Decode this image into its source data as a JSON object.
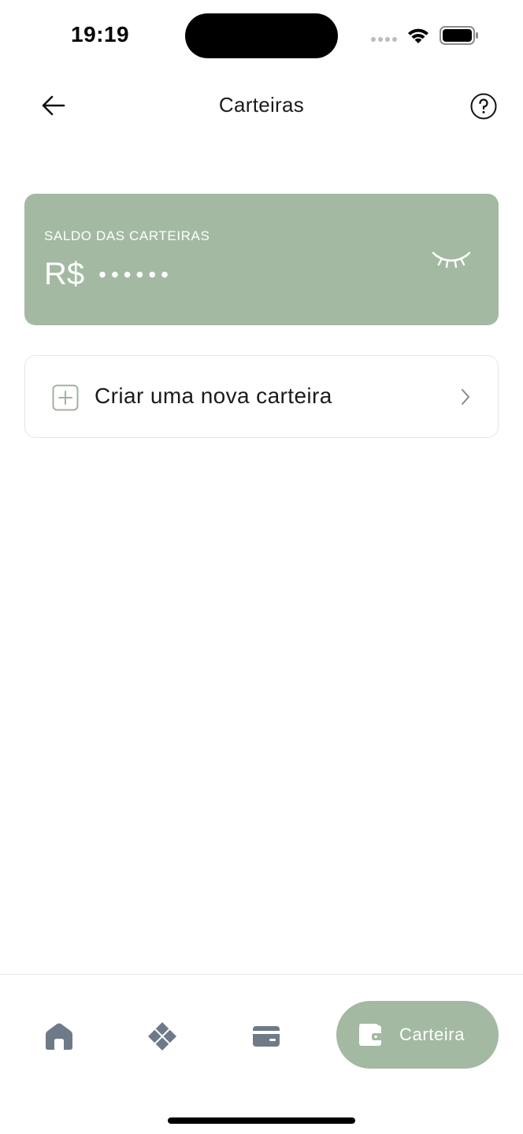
{
  "status_bar": {
    "time": "19:19"
  },
  "header": {
    "title": "Carteiras",
    "back_icon": "arrow-left-icon",
    "help_icon": "question-circle-icon"
  },
  "balance_card": {
    "label": "SALDO DAS CARTEIRAS",
    "currency": "R$",
    "masked_value": "••••••",
    "visibility_icon": "eye-closed-icon",
    "background_color": "#a3b9a2"
  },
  "create_wallet": {
    "label": "Criar uma nova carteira",
    "icon": "plus-square-icon",
    "chevron_icon": "chevron-right-icon"
  },
  "bottom_nav": {
    "items": [
      {
        "icon": "home-icon"
      },
      {
        "icon": "pix-icon"
      },
      {
        "icon": "card-icon"
      },
      {
        "icon": "wallet-icon",
        "label": "Carteira",
        "active": true
      }
    ],
    "active_color": "#a3b9a2",
    "inactive_icon_color": "#6e7a87"
  }
}
